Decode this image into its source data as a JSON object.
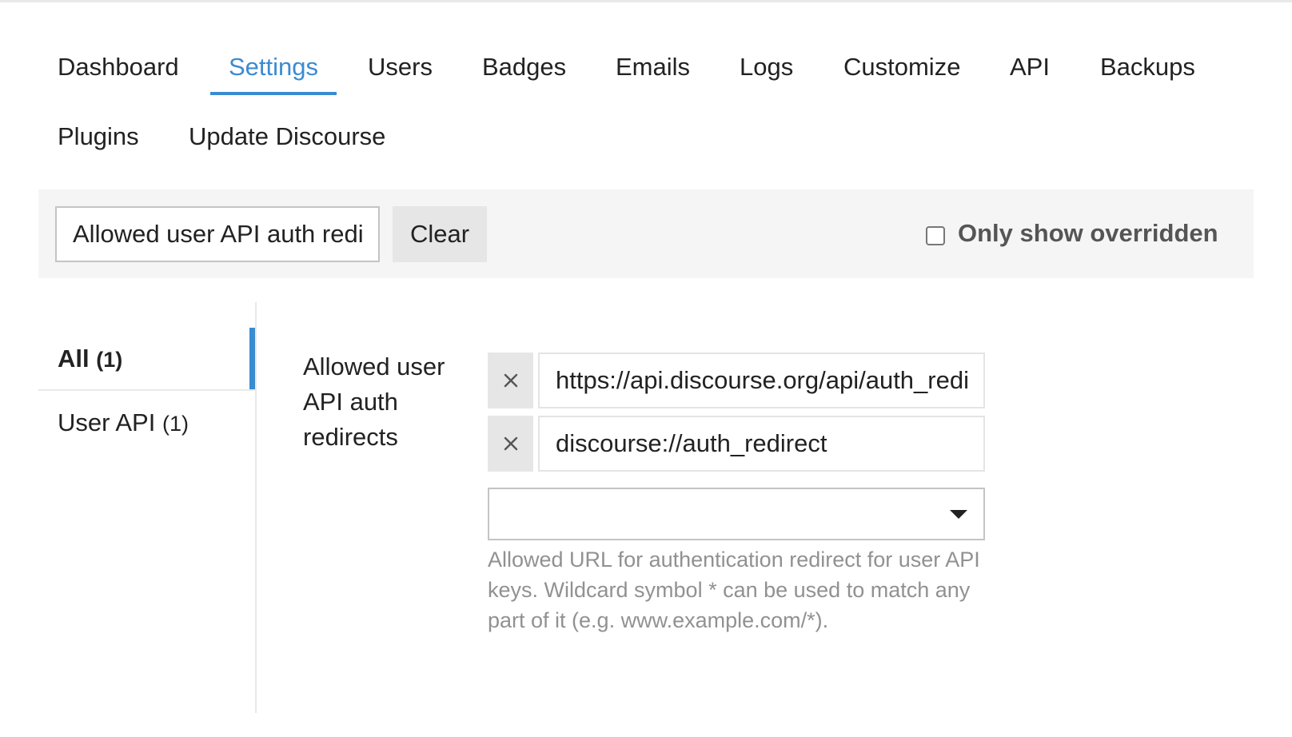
{
  "nav": {
    "tabs": [
      {
        "label": "Dashboard"
      },
      {
        "label": "Settings"
      },
      {
        "label": "Users"
      },
      {
        "label": "Badges"
      },
      {
        "label": "Emails"
      },
      {
        "label": "Logs"
      },
      {
        "label": "Customize"
      },
      {
        "label": "API"
      },
      {
        "label": "Backups"
      },
      {
        "label": "Plugins"
      },
      {
        "label": "Update Discourse"
      }
    ],
    "active_tab": "Settings"
  },
  "filter": {
    "search_value": "Allowed user API auth redirects",
    "clear_label": "Clear",
    "only_overridden_label": "Only show overridden",
    "only_overridden_checked": false
  },
  "categories": [
    {
      "label": "All",
      "count": "(1)",
      "active": true
    },
    {
      "label": "User API",
      "count": "(1)",
      "active": false
    }
  ],
  "setting": {
    "label": "Allowed user API auth redirects",
    "values": [
      "https://api.discourse.org/api/auth_redirect",
      "discourse://auth_redirect"
    ],
    "remove_icon": "close-icon",
    "add_select_value": "",
    "description": "Allowed URL for authentication redirect for user API keys. Wildcard symbol * can be used to match any part of it (e.g. www.example.com/*)."
  },
  "colors": {
    "accent": "#3b8bd1",
    "filter_bar_bg": "#f5f5f5",
    "button_bg": "#e6e6e6",
    "description_text": "#919191"
  }
}
